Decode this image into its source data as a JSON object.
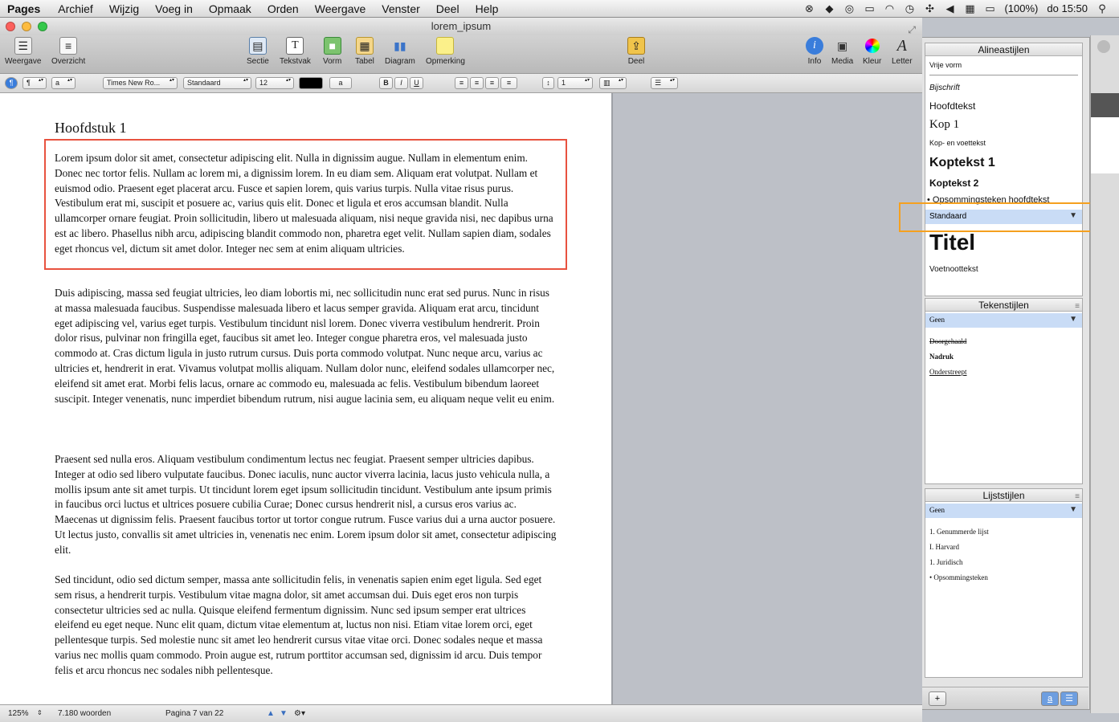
{
  "menubar": {
    "app": "Pages",
    "items": [
      "Archief",
      "Wijzig",
      "Voeg in",
      "Opmaak",
      "Orden",
      "Weergave",
      "Venster",
      "Deel",
      "Help"
    ],
    "battery": "(100%)",
    "clock": "do 15:50"
  },
  "window": {
    "title": "lorem_ipsum"
  },
  "toolbar": {
    "weergave": "Weergave",
    "overzicht": "Overzicht",
    "sectie": "Sectie",
    "tekstvak": "Tekstvak",
    "vorm": "Vorm",
    "tabel": "Tabel",
    "diagram": "Diagram",
    "opmerking": "Opmerking",
    "deel": "Deel",
    "info": "Info",
    "media": "Media",
    "kleur": "Kleur",
    "letter": "Letter"
  },
  "formatbar": {
    "font": "Times New Ro...",
    "typeface": "Standaard",
    "size": "12",
    "char_a": "a",
    "bold": "B",
    "italic": "I",
    "underline": "U",
    "spacing": "1"
  },
  "document": {
    "chapter": "Hoofdstuk 1",
    "paragraphs": [
      "Lorem ipsum dolor sit amet, consectetur adipiscing elit. Nulla in dignissim augue. Nullam in elementum enim. Donec nec tortor felis. Nullam ac lorem mi, a dignissim lorem. In eu diam sem. Aliquam erat volutpat. Nullam et euismod odio. Praesent eget placerat arcu. Fusce et sapien lorem, quis varius turpis. Nulla vitae risus purus. Vestibulum erat mi, suscipit et posuere ac, varius quis elit. Donec et ligula et eros accumsan blandit. Nulla ullamcorper ornare feugiat. Proin sollicitudin, libero ut malesuada aliquam, nisi neque gravida nisi, nec dapibus urna est ac libero. Phasellus nibh arcu, adipiscing blandit commodo non, pharetra eget velit. Nullam sapien diam, sodales eget rhoncus vel, dictum sit amet dolor. Integer nec sem at enim aliquam ultricies.",
      "Duis adipiscing, massa sed feugiat ultricies, leo diam lobortis mi, nec sollicitudin nunc erat sed purus. Nunc in risus at massa malesuada faucibus. Suspendisse malesuada libero et lacus semper gravida. Aliquam erat arcu, tincidunt eget adipiscing vel, varius eget turpis. Vestibulum tincidunt nisl lorem. Donec viverra vestibulum hendrerit. Proin dolor risus, pulvinar non fringilla eget, faucibus sit amet leo. Integer congue pharetra eros, vel malesuada justo commodo at. Cras dictum ligula in justo rutrum cursus. Duis porta commodo volutpat. Nunc neque arcu, varius ac ultricies et, hendrerit in erat. Vivamus volutpat mollis aliquam. Nullam dolor nunc, eleifend sodales ullamcorper nec, eleifend sit amet erat. Morbi felis lacus, ornare ac commodo eu, malesuada ac felis. Vestibulum bibendum laoreet suscipit. Integer venenatis, nunc imperdiet bibendum rutrum, nisi augue lacinia sem, eu aliquam neque velit eu enim.",
      "Praesent sed nulla eros. Aliquam vestibulum condimentum lectus nec feugiat. Praesent semper ultricies dapibus. Integer at odio sed libero vulputate faucibus. Donec iaculis, nunc auctor viverra lacinia, lacus justo vehicula nulla, a mollis ipsum ante sit amet turpis. Ut tincidunt lorem eget ipsum sollicitudin tincidunt. Vestibulum ante ipsum primis in faucibus orci luctus et ultrices posuere cubilia Curae; Donec cursus hendrerit nisl, a cursus eros varius ac. Maecenas ut dignissim felis. Praesent faucibus tortor ut tortor congue rutrum. Fusce varius dui a urna auctor posuere. Ut lectus justo, convallis sit amet ultricies in, venenatis nec enim. Lorem ipsum dolor sit amet, consectetur adipiscing elit.",
      "Sed tincidunt, odio sed dictum semper, massa ante sollicitudin felis, in venenatis sapien enim eget ligula. Sed eget sem risus, a hendrerit turpis. Vestibulum vitae magna dolor, sit amet accumsan dui. Duis eget eros non turpis consectetur ultricies sed ac nulla. Quisque eleifend fermentum dignissim. Nunc sed ipsum semper erat ultrices eleifend eu eget neque. Nunc elit quam, dictum vitae elementum at, luctus non nisi. Etiam vitae lorem orci, eget pellentesque turpis. Sed molestie nunc sit amet leo hendrerit cursus vitae vitae orci. Donec sodales neque et massa varius nec mollis quam commodo. Proin augue est, rutrum porttitor accumsan sed, dignissim id arcu. Duis tempor felis et arcu rhoncus nec sodales nibh pellentesque."
    ]
  },
  "statusbar": {
    "zoom": "125%",
    "words": "7.180 woorden",
    "page": "Pagina 7 van 22"
  },
  "styles": {
    "paragraph_title": "Alineastijlen",
    "paragraph_items": {
      "vrije_vorm": "Vrije vorm",
      "bijschrift": "Bijschrift",
      "hoofdtekst": "Hoofdtekst",
      "kop1": "Kop 1",
      "kop_voet": "Kop- en voettekst",
      "koptekst1": "Koptekst 1",
      "koptekst2": "Koptekst 2",
      "opsomming_hoofd": "Opsommingsteken hoofdtekst",
      "standaard": "Standaard",
      "titel": "Titel",
      "voetnoot": "Voetnoottekst"
    },
    "char_title": "Tekenstijlen",
    "char_selected": "Geen",
    "char_items": {
      "doorgehaald": "Doorgehaald",
      "nadruk": "Nadruk",
      "onderstreept": "Onderstreept"
    },
    "list_title": "Lijststijlen",
    "list_selected": "Geen",
    "list_items": {
      "genummerd": "1. Genummerde lijst",
      "harvard": "I. Harvard",
      "juridisch": "1. Juridisch",
      "opsomming": "• Opsommingsteken"
    },
    "add_button": "+",
    "char_toggle": "a"
  },
  "colors": {
    "selection": "#c9dcf6",
    "red_box": "#e8523f",
    "orange_box": "#f5a01f"
  }
}
